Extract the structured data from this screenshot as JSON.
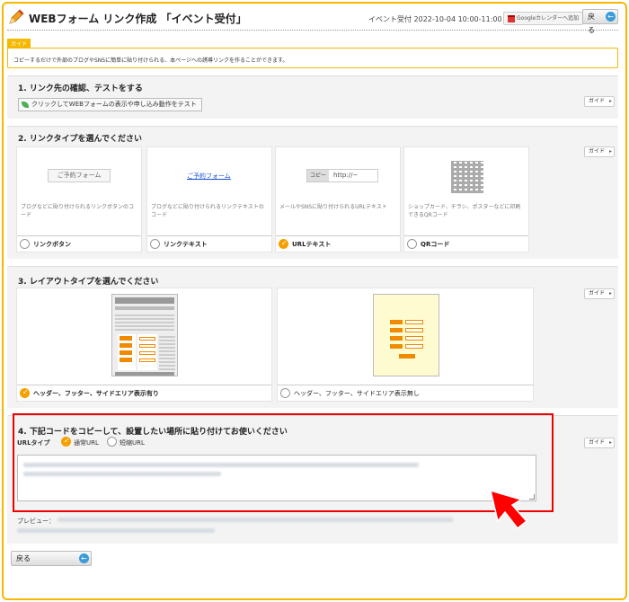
{
  "header": {
    "title": "WEBフォーム リンク作成 「イベント受付」",
    "event_info": "イベント受付 2022-10-04 10:00-11:00",
    "gcal_label": "Googleカレンダーへ追加",
    "back_label": "戻る"
  },
  "guide": {
    "tag": "ガイド",
    "text": "コピーするだけで外部のブログやSNSに簡単に貼り付けられる、本ページへの誘導リンクを作ることができます。"
  },
  "section1": {
    "title": "1. リンク先の確認、テストをする",
    "test_button": "クリックしてWEBフォームの表示や申し込み動作をテスト",
    "guide_label": "ガイド"
  },
  "section2": {
    "title": "2. リンクタイプを選んでください",
    "guide_label": "ガイド",
    "cards": [
      {
        "preview": "ご予約フォーム",
        "desc": "ブログなどに貼り付けられるリンクボタンのコード",
        "label": "リンクボタン",
        "checked": false
      },
      {
        "preview": "ご予約フォーム",
        "desc": "ブログなどに貼り付けられるリンクテキストのコード",
        "label": "リンクテキスト",
        "checked": false
      },
      {
        "preview_copy": "コピー",
        "preview_url": "http://~",
        "desc": "メールやSNSに貼り付けられるURLテキスト",
        "label": "URLテキスト",
        "checked": true
      },
      {
        "desc": "ショップカード、チラシ、ポスターなどに印刷できるQRコード",
        "label": "QRコード",
        "checked": false
      }
    ]
  },
  "section3": {
    "title": "3. レイアウトタイプを選んでください",
    "guide_label": "ガイド",
    "options": [
      {
        "label": "ヘッダー、フッター、サイドエリア表示有り",
        "checked": true
      },
      {
        "label": "ヘッダー、フッター、サイドエリア表示無し",
        "checked": false
      }
    ]
  },
  "section4": {
    "title": "4. 下記コードをコピーして、設置したい場所に貼り付けてお使いください",
    "guide_label": "ガイド",
    "url_type_label": "URLタイプ",
    "url_options": [
      {
        "label": "通常URL",
        "checked": true
      },
      {
        "label": "短縮URL",
        "checked": false
      }
    ],
    "preview_label": "プレビュー："
  },
  "footer": {
    "back_label": "戻る"
  },
  "colors": {
    "accent": "#f5b800",
    "check": "#f5a000",
    "highlight": "#e00000",
    "link": "#1a4fd6"
  }
}
